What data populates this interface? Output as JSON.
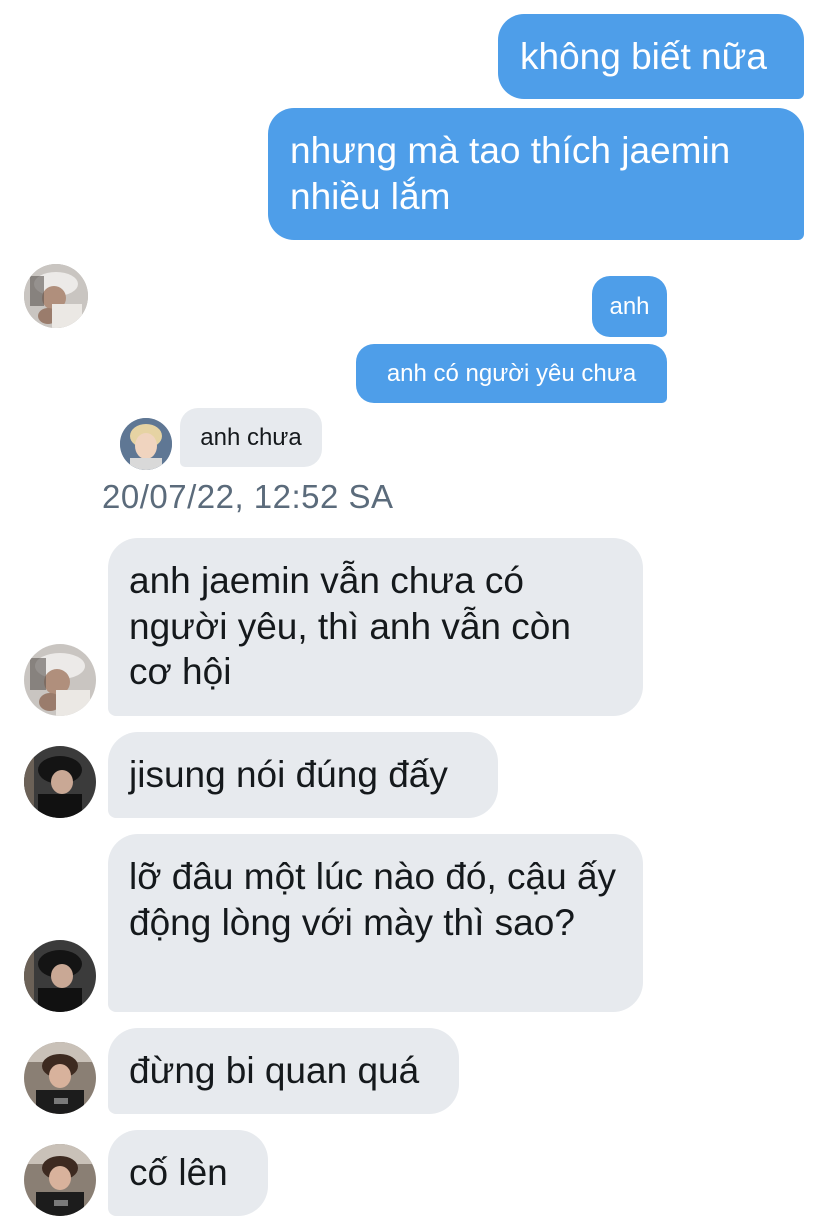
{
  "messages": {
    "m1": "không biết nữa",
    "m2": "nhưng mà tao thích jaemin nhiều lắm",
    "m3": "anh",
    "m4": "anh có người yêu chưa",
    "m5": "anh chưa",
    "timestamp": "20/07/22, 12:52 SA",
    "m6": "anh jaemin vẫn chưa có người yêu, thì anh vẫn còn cơ hội",
    "m7": "jisung nói đúng đấy",
    "m8": "lỡ đâu một lúc nào đó, cậu ấy động lòng với mày thì sao?",
    "m9": "đừng bi quan quá",
    "m10": "cố lên"
  },
  "colors": {
    "outgoing_bubble": "#4e9ee9",
    "incoming_bubble": "#e7eaee",
    "timestamp_text": "#5b6b7b"
  }
}
